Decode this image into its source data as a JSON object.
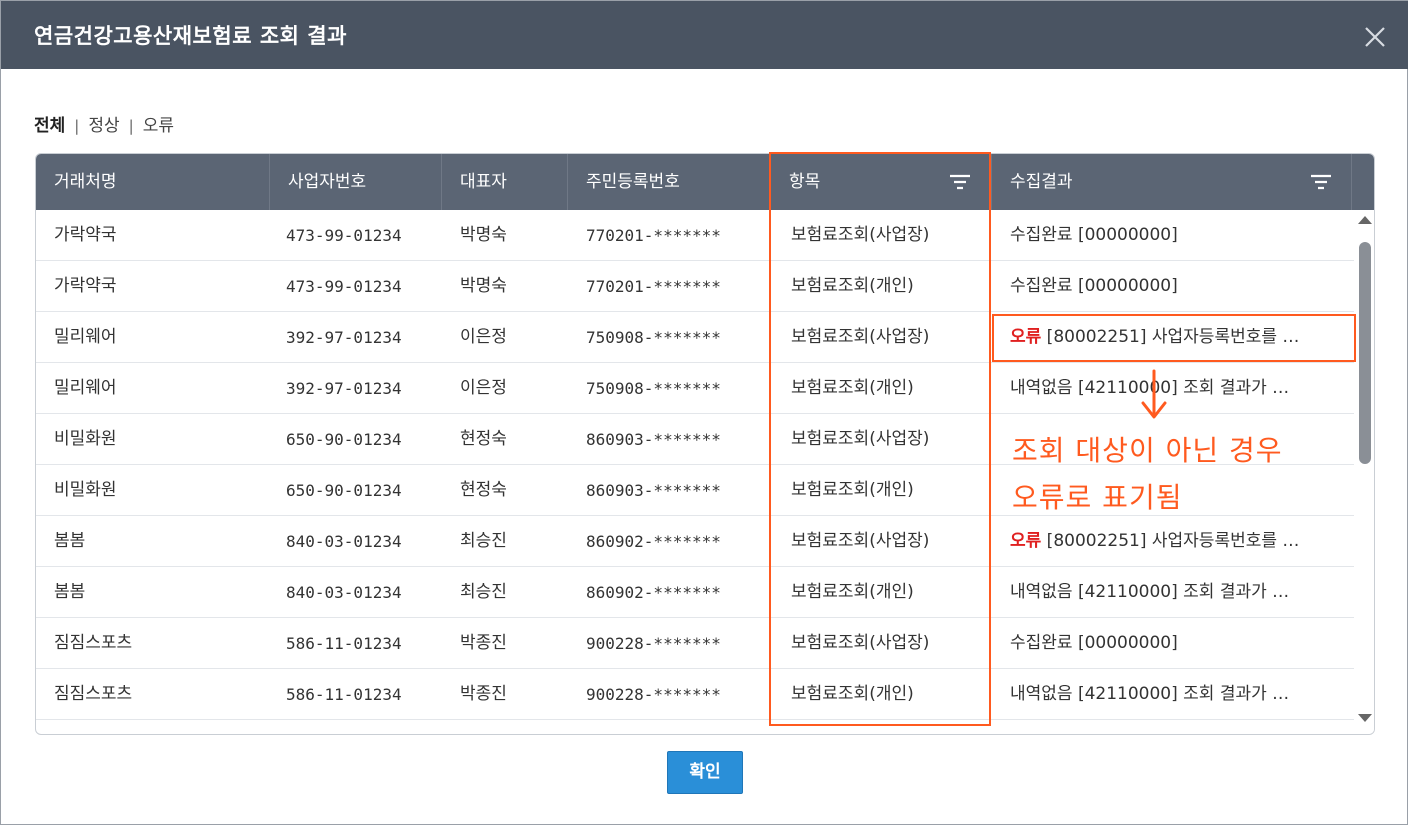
{
  "dialog": {
    "title": "연금건강고용산재보험료 조회 결과",
    "ok_label": "확인"
  },
  "filters": [
    {
      "label": "전체",
      "active": true
    },
    {
      "label": "정상",
      "active": false
    },
    {
      "label": "오류",
      "active": false
    }
  ],
  "filter_separator": "|",
  "table": {
    "columns": [
      "거래처명",
      "사업자번호",
      "대표자",
      "주민등록번호",
      "항목",
      "수집결과"
    ],
    "rows": [
      {
        "name": "가락약국",
        "bizno": "473-99-01234",
        "ceo": "박명숙",
        "rrn": "770201-*******",
        "item": "보험료조회(사업장)",
        "status": "",
        "result": "수집완료 [00000000]"
      },
      {
        "name": "가락약국",
        "bizno": "473-99-01234",
        "ceo": "박명숙",
        "rrn": "770201-*******",
        "item": "보험료조회(개인)",
        "status": "",
        "result": "수집완료 [00000000]"
      },
      {
        "name": "밀리웨어",
        "bizno": "392-97-01234",
        "ceo": "이은정",
        "rrn": "750908-*******",
        "item": "보험료조회(사업장)",
        "status": "오류",
        "result": " [80002251] 사업자등록번호를 …"
      },
      {
        "name": "밀리웨어",
        "bizno": "392-97-01234",
        "ceo": "이은정",
        "rrn": "750908-*******",
        "item": "보험료조회(개인)",
        "status": "",
        "result": "내역없음 [42110000] 조회 결과가 …"
      },
      {
        "name": "비밀화원",
        "bizno": "650-90-01234",
        "ceo": "현정숙",
        "rrn": "860903-*******",
        "item": "보험료조회(사업장)",
        "status": "",
        "result": ""
      },
      {
        "name": "비밀화원",
        "bizno": "650-90-01234",
        "ceo": "현정숙",
        "rrn": "860903-*******",
        "item": "보험료조회(개인)",
        "status": "",
        "result": ""
      },
      {
        "name": "봄봄",
        "bizno": "840-03-01234",
        "ceo": "최승진",
        "rrn": "860902-*******",
        "item": "보험료조회(사업장)",
        "status": "오류",
        "result": " [80002251] 사업자등록번호를 …"
      },
      {
        "name": "봄봄",
        "bizno": "840-03-01234",
        "ceo": "최승진",
        "rrn": "860902-*******",
        "item": "보험료조회(개인)",
        "status": "",
        "result": "내역없음 [42110000] 조회 결과가 …"
      },
      {
        "name": "짐짐스포츠",
        "bizno": "586-11-01234",
        "ceo": "박종진",
        "rrn": "900228-*******",
        "item": "보험료조회(사업장)",
        "status": "",
        "result": "수집완료 [00000000]"
      },
      {
        "name": "짐짐스포츠",
        "bizno": "586-11-01234",
        "ceo": "박종진",
        "rrn": "900228-*******",
        "item": "보험료조회(개인)",
        "status": "",
        "result": "내역없음 [42110000] 조회 결과가 …"
      }
    ]
  },
  "annotation": {
    "line1": "조회 대상이 아닌 경우",
    "line2": "오류로 표기됨",
    "color": "#ff5a1f"
  },
  "colors": {
    "header_bg": "#5b6574",
    "titlebar_bg": "#4a5462",
    "error": "#e02020",
    "button": "#2a8fd8"
  },
  "icons": [
    "close-icon",
    "filter-icon",
    "scroll-up-icon",
    "scroll-down-icon",
    "arrow-down-icon"
  ]
}
